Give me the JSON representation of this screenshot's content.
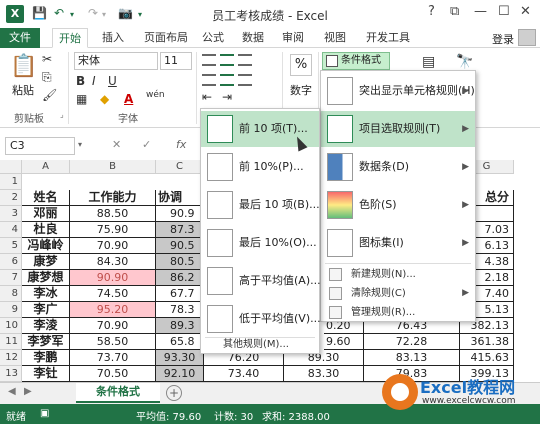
{
  "window": {
    "title": "员工考核成绩 - Excel",
    "help": "?",
    "restore": "⧉",
    "minimize": "—",
    "maximize": "☐",
    "close": "✕"
  },
  "tabs": [
    "文件",
    "开始",
    "插入",
    "页面布局",
    "公式",
    "数据",
    "审阅",
    "视图",
    "开发工具"
  ],
  "login": "登录",
  "ribbon": {
    "clipboard_label": "剪贴板",
    "paste_label": "粘贴",
    "font_label": "字体",
    "font_name": "宋体",
    "font_size": "11",
    "number_label": "数字",
    "number_symbol": "%",
    "bold": "B",
    "italic": "I",
    "underline": "U",
    "font_color": "A",
    "wen": "wén",
    "cf_button": "条件格式"
  },
  "formula_bar": {
    "name_box": "C3",
    "fx": "fx"
  },
  "columns": [
    "A",
    "B",
    "C",
    "D",
    "E",
    "F",
    "G"
  ],
  "rows": [
    "1",
    "2",
    "3",
    "4",
    "5",
    "6",
    "7",
    "8",
    "9",
    "10",
    "11",
    "12",
    "13"
  ],
  "table": {
    "headers": [
      "姓名",
      "工作能力",
      "协调",
      "总分"
    ],
    "body": [
      {
        "name": "邓丽",
        "ability": "88.50",
        "coord": "90.9",
        "total": ""
      },
      {
        "name": "杜良",
        "ability": "75.90",
        "coord": "87.3",
        "total": "7.03"
      },
      {
        "name": "冯峰岭",
        "ability": "70.90",
        "coord": "90.5",
        "total": "6.13"
      },
      {
        "name": "康梦",
        "ability": "84.30",
        "coord": "80.5",
        "total": "4.38"
      },
      {
        "name": "康梦想",
        "ability": "90.90",
        "coord": "86.2",
        "total": "2.18"
      },
      {
        "name": "李冰",
        "ability": "74.50",
        "coord": "67.7",
        "total": "7.40"
      },
      {
        "name": "李广",
        "ability": "95.20",
        "coord": "78.3",
        "total": "5.13"
      },
      {
        "name": "李淩",
        "ability": "70.90",
        "coord": "89.3",
        "e": "0.20",
        "f": "76.43",
        "total": "382.13"
      },
      {
        "name": "李梦军",
        "ability": "58.50",
        "coord": "65.8",
        "e": "9.60",
        "f": "72.28",
        "total": "361.38"
      },
      {
        "name": "李鹏",
        "ability": "73.70",
        "coord": "93.30",
        "d": "76.20",
        "e": "89.30",
        "f": "83.13",
        "total": "415.63"
      },
      {
        "name": "李钍",
        "ability": "70.50",
        "coord": "92.10",
        "d": "73.40",
        "e": "83.30",
        "f": "79.83",
        "total": "399.13"
      }
    ]
  },
  "sheet_tab": "条件格式",
  "add_sheet": "+",
  "status": {
    "ready": "就绪",
    "average": "平均值: 79.60",
    "count": "计数: 30",
    "sum": "求和: 2388.00"
  },
  "cf_menu": {
    "highlight": "突出显示单元格规则(H)",
    "topbottom": "项目选取规则(T)",
    "databar": "数据条(D)",
    "colorscale": "色阶(S)",
    "iconset": "图标集(I)",
    "new_rule": "新建规则(N)...",
    "clear_rule": "清除规则(C)",
    "manage_rule": "管理规则(R)..."
  },
  "sub_menu": {
    "top10": "前 10 项(T)...",
    "top10pct": "前 10%(P)...",
    "bottom10": "最后 10 项(B)...",
    "bottom10pct": "最后 10%(O)...",
    "above_avg": "高于平均值(A)...",
    "below_avg": "低于平均值(V)...",
    "other": "其他规则(M)..."
  },
  "watermark": {
    "brand": "Excel教程网",
    "url": "www.excelcwcw.com"
  },
  "colors": {
    "accent": "#217346",
    "pink_fill": "#ffc7ce",
    "highlight": "#bfe3c9",
    "grey_fill": "#c8c8c8"
  }
}
